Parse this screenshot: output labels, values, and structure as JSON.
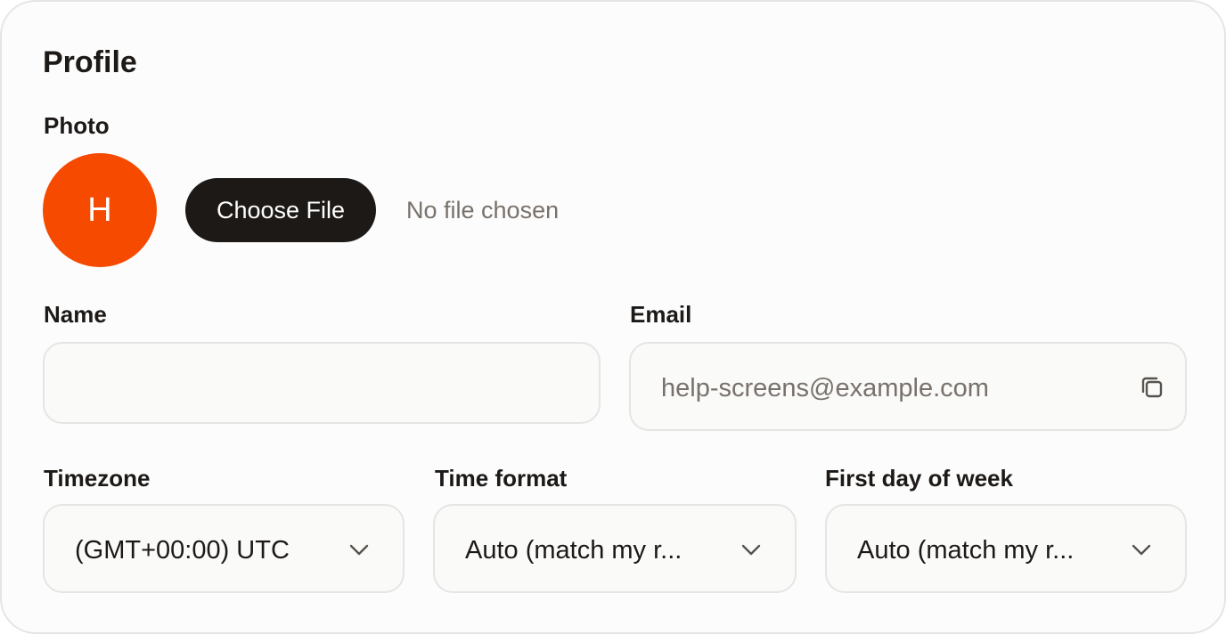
{
  "profile": {
    "title": "Profile",
    "photo": {
      "label": "Photo",
      "avatar_initial": "H",
      "avatar_color": "#f54a00",
      "choose_file_label": "Choose File",
      "file_status": "No file chosen"
    },
    "name": {
      "label": "Name",
      "value": ""
    },
    "email": {
      "label": "Email",
      "value": "help-screens@example.com",
      "icon": "copy-icon"
    },
    "timezone": {
      "label": "Timezone",
      "value": "(GMT+00:00) UTC"
    },
    "time_format": {
      "label": "Time format",
      "value": "Auto (match my r..."
    },
    "first_day": {
      "label": "First day of week",
      "value": "Auto (match my r..."
    }
  },
  "colors": {
    "accent": "#f54a00",
    "button_dark": "#1c1917",
    "muted_text": "#78716c",
    "border": "#e7e5e4"
  }
}
